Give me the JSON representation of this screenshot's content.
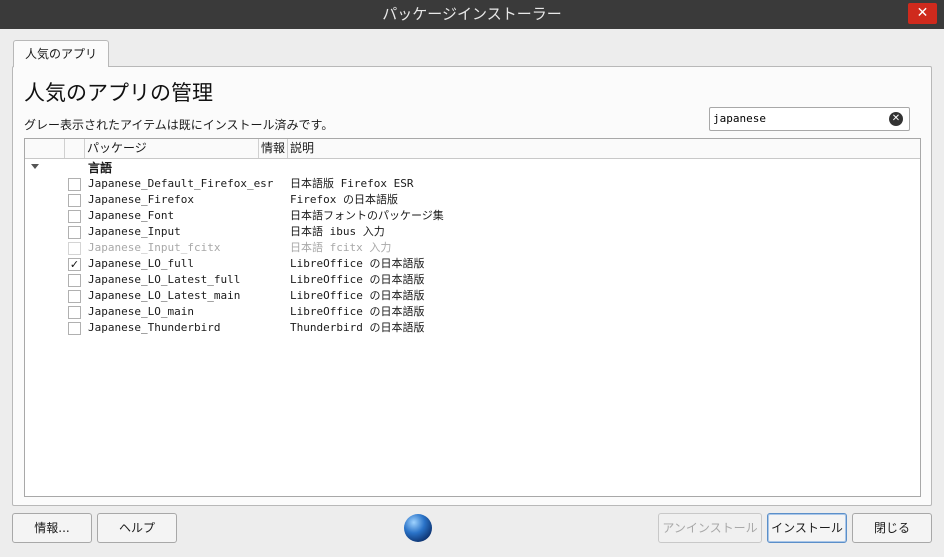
{
  "window": {
    "title": "パッケージインストーラー",
    "close_label": "✕"
  },
  "tabs": [
    {
      "label": "人気のアプリ",
      "active": true
    }
  ],
  "main": {
    "title": "人気のアプリの管理",
    "subtitle": "グレー表示されたアイテムは既にインストール済みです。",
    "search": {
      "value": "japanese",
      "placeholder": ""
    }
  },
  "table": {
    "headers": [
      "パッケージ",
      "情報",
      "説明"
    ],
    "group": "言語",
    "rows": [
      {
        "name": "Japanese_Default_Firefox_esr",
        "desc": "日本語版 Firefox ESR",
        "checked": false,
        "installed": false
      },
      {
        "name": "Japanese_Firefox",
        "desc": "Firefox の日本語版",
        "checked": false,
        "installed": false
      },
      {
        "name": "Japanese_Font",
        "desc": "日本語フォントのパッケージ集",
        "checked": false,
        "installed": false
      },
      {
        "name": "Japanese_Input",
        "desc": "日本語 ibus 入力",
        "checked": false,
        "installed": false
      },
      {
        "name": "Japanese_Input_fcitx",
        "desc": "日本語 fcitx 入力",
        "checked": false,
        "installed": true
      },
      {
        "name": "Japanese_LO_full",
        "desc": "LibreOffice の日本語版",
        "checked": true,
        "installed": false
      },
      {
        "name": "Japanese_LO_Latest_full",
        "desc": "LibreOffice の日本語版",
        "checked": false,
        "installed": false
      },
      {
        "name": "Japanese_LO_Latest_main",
        "desc": "LibreOffice の日本語版",
        "checked": false,
        "installed": false
      },
      {
        "name": "Japanese_LO_main",
        "desc": "LibreOffice の日本語版",
        "checked": false,
        "installed": false
      },
      {
        "name": "Japanese_Thunderbird",
        "desc": "Thunderbird の日本語版",
        "checked": false,
        "installed": false
      }
    ]
  },
  "buttons": {
    "info": "情報...",
    "help": "ヘルプ",
    "uninstall": "アンインストール",
    "install": "インストール",
    "close": "閉じる"
  },
  "icons": {
    "globe": "globe-icon",
    "check": "✓"
  }
}
